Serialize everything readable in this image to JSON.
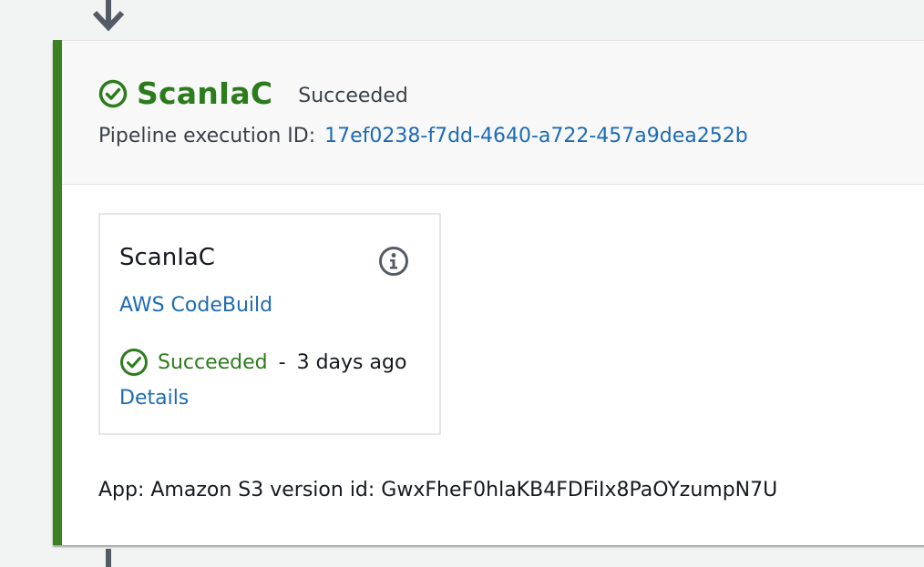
{
  "stage": {
    "name": "ScanIaC",
    "status": "Succeeded",
    "execution_label": "Pipeline execution ID:",
    "execution_id": "17ef0238-f7dd-4640-a722-457a9dea252b",
    "accent_color": "#3b8122"
  },
  "action": {
    "name": "ScanIaC",
    "provider": "AWS CodeBuild",
    "status": "Succeeded",
    "separator": "-",
    "time_ago": "3 days ago",
    "details_label": "Details",
    "icons": [
      "check-circle-icon",
      "info-icon"
    ]
  },
  "artifact": {
    "text": "App: Amazon S3 version id: GwxFheF0hlaKB4FDFiIx8PaOYzumpN7U"
  },
  "colors": {
    "success": "#2c7c1d",
    "link": "#1d6bb5"
  }
}
